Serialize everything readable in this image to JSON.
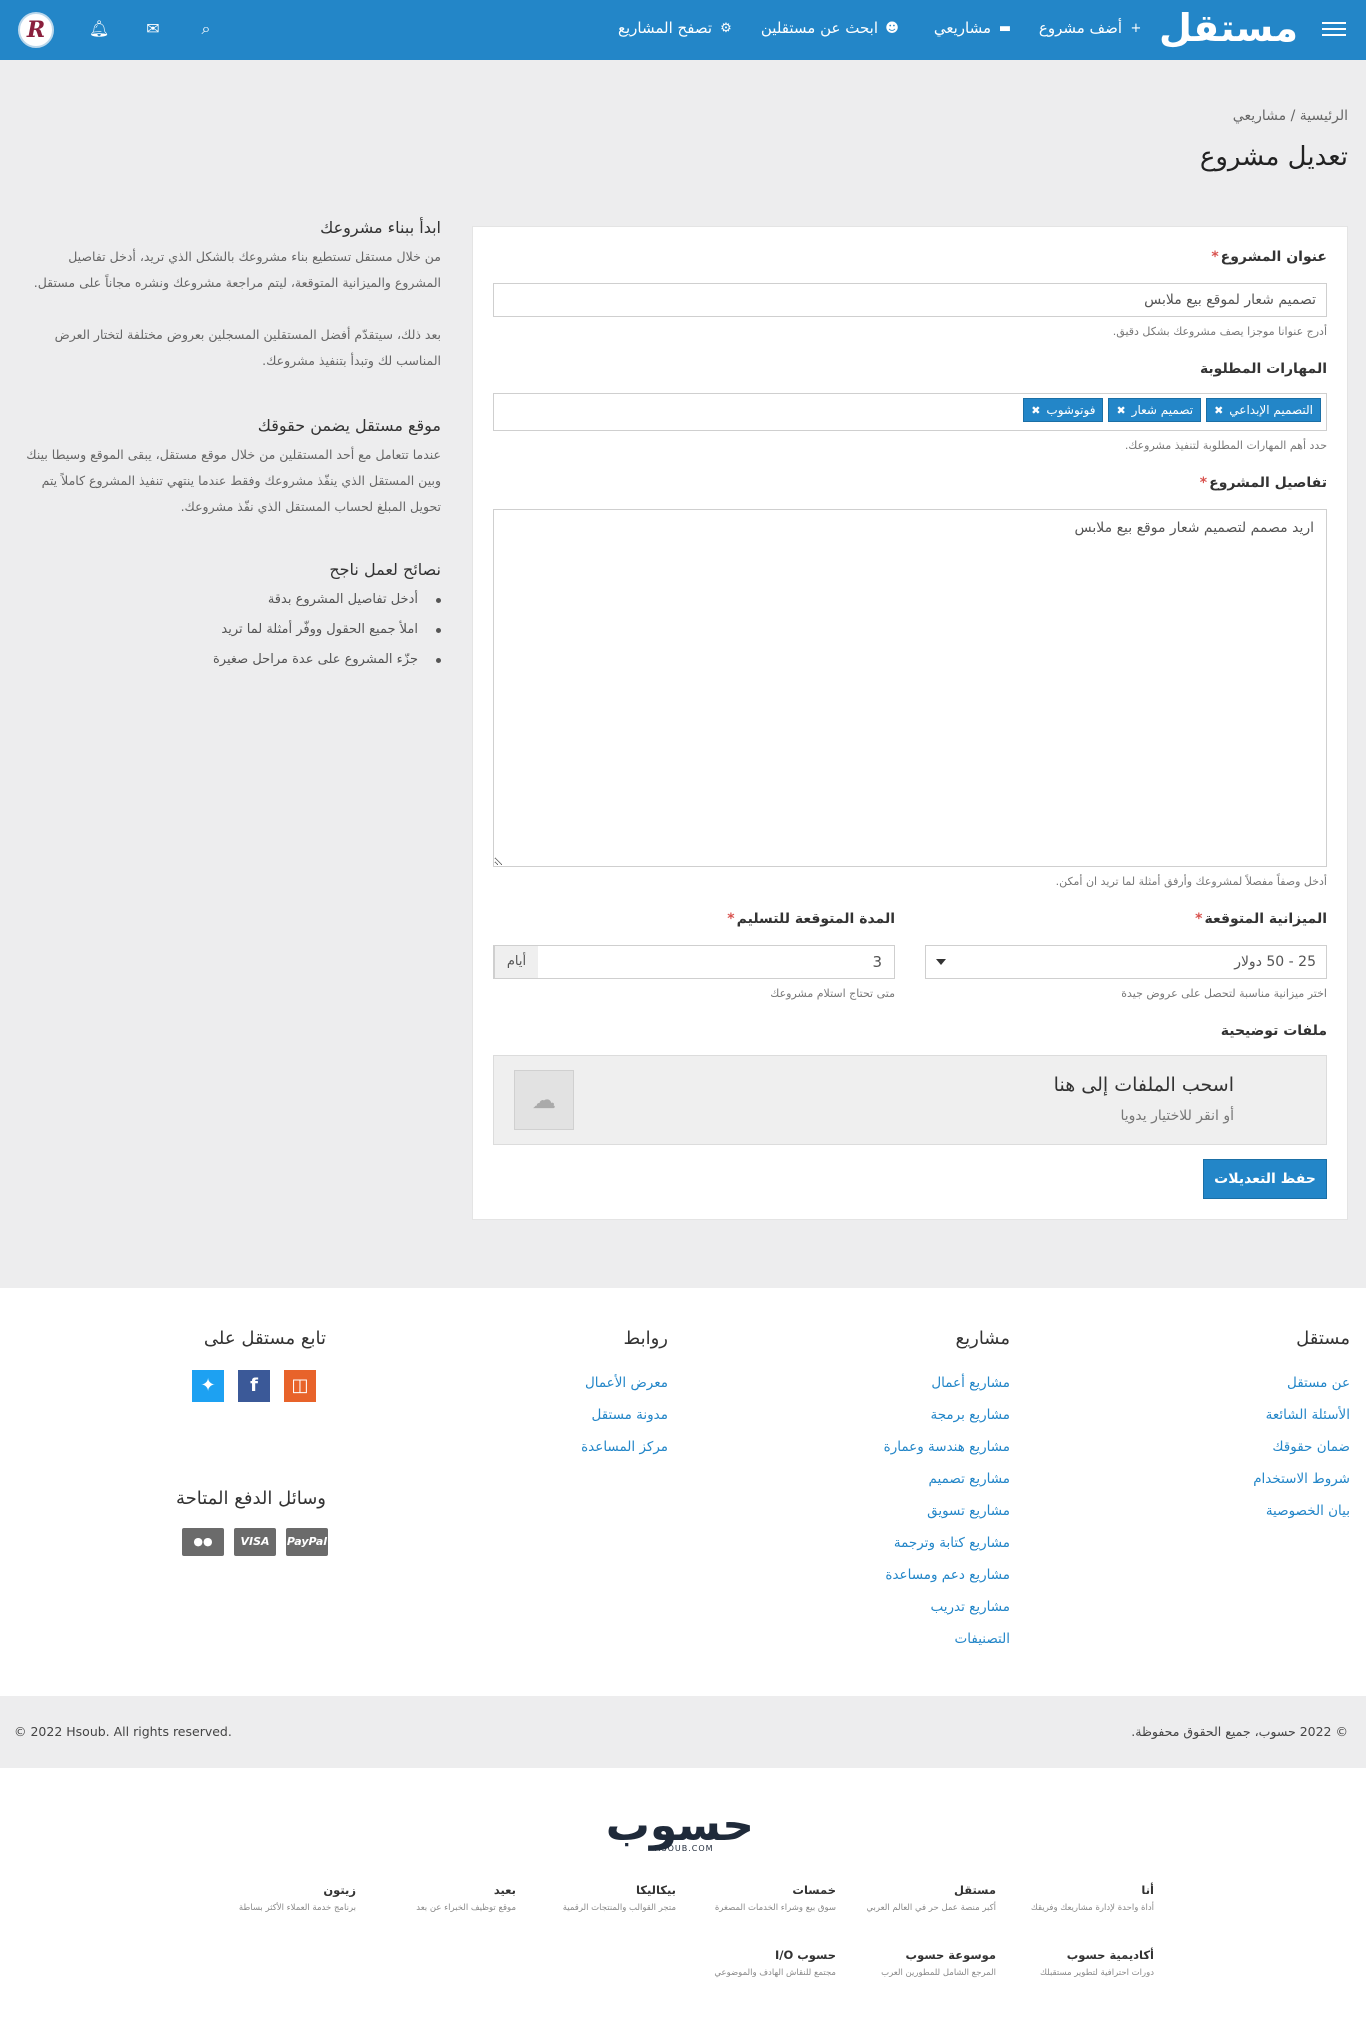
{
  "nav": {
    "logo": "مستقل",
    "items": [
      {
        "label": "أضف مشروع",
        "icon": "+"
      },
      {
        "label": "مشاريعي",
        "icon": "▬"
      },
      {
        "label": "ابحث عن مستقلين",
        "icon": "☻"
      },
      {
        "label": "تصفح المشاريع",
        "icon": "⚙"
      }
    ],
    "avatar_letter": "R"
  },
  "breadcrumb": {
    "home": "الرئيسية",
    "sep": "/",
    "current": "مشاريعي"
  },
  "page_title": "تعديل مشروع",
  "form": {
    "title_label": "عنوان المشروع",
    "title_value": "تصميم شعار لموقع بيع ملابس",
    "title_hint": "أدرج عنوانا موجزا يصف مشروعك بشكل دقيق.",
    "skills_label": "المهارات المطلوبة",
    "skills": [
      "التصميم الإبداعي",
      "تصميم شعار",
      "فوتوشوب"
    ],
    "skills_hint": "حدد أهم المهارات المطلوبة لتنفيذ مشروعك.",
    "details_label": "تفاصيل المشروع",
    "details_value": "اريد مصمم لتصميم شعار موقع بيع ملابس",
    "details_hint": "أدخل وصفاً مفصلاً لمشروعك وأرفق أمثلة لما تريد ان أمكن.",
    "budget_label": "الميزانية المتوقعة",
    "budget_value": "25 - 50 دولار",
    "budget_hint": "اختر ميزانية مناسبة لتحصل على عروض جيدة",
    "duration_label": "المدة المتوقعة للتسليم",
    "duration_value": "3",
    "duration_unit": "أيام",
    "duration_hint": "متى تحتاج استلام مشروعك",
    "files_label": "ملفات توضيحية",
    "drop_title": "اسحب الملفات إلى هنا",
    "drop_sub": "أو انقر للاختيار يدويا",
    "save_label": "حفظ التعديلات"
  },
  "side": {
    "s1_title": "ابدأ ببناء مشروعك",
    "s1_text1": "من خلال مستقل تستطيع بناء مشروعك بالشكل الذي تريد، أدخل تفاصيل المشروع والميزانية المتوقعة، ليتم مراجعة مشروعك ونشره مجاناً على مستقل.",
    "s1_text2": "بعد ذلك، سيتقدّم أفضل المستقلين المسجلين بعروض مختلفة لتختار العرض المناسب لك وتبدأ بتنفيذ مشروعك.",
    "s2_title": "موقع مستقل يضمن حقوقك",
    "s2_text": "عندما تتعامل مع أحد المستقلين من خلال موقع مستقل، يبقى الموقع وسيطا بينك وبين المستقل الذي ينفّذ مشروعك وفقط عندما ينتهي تنفيذ المشروع كاملاً يتم تحويل المبلغ لحساب المستقل الذي نفّذ مشروعك.",
    "s3_title": "نصائح لعمل ناجح",
    "tips": [
      "أدخل تفاصيل المشروع بدقة",
      "املأ جميع الحقول ووفّر أمثلة لما تريد",
      "جزّء المشروع على عدة مراحل صغيرة"
    ]
  },
  "footer": {
    "col1": {
      "title": "مستقل",
      "links": [
        "عن مستقل",
        "الأسئلة الشائعة",
        "ضمان حقوقك",
        "شروط الاستخدام",
        "بيان الخصوصية"
      ]
    },
    "col2": {
      "title": "مشاريع",
      "links": [
        "مشاريع أعمال",
        "مشاريع برمجة",
        "مشاريع هندسة وعمارة",
        "مشاريع تصميم",
        "مشاريع تسويق",
        "مشاريع كتابة وترجمة",
        "مشاريع دعم ومساعدة",
        "مشاريع تدريب",
        "التصنيفات"
      ]
    },
    "col3": {
      "title": "روابط",
      "links": [
        "معرض الأعمال",
        "مدونة مستقل",
        "مركز المساعدة"
      ]
    },
    "follow_title": "تابع مستقل على",
    "pay_title": "وسائل الدفع المتاحة",
    "pay": [
      "PayPal",
      "VISA",
      "●●"
    ],
    "copy_ar": "© 2022 حسوب، جميع الحقوق محفوظة.",
    "copy_en": "© 2022 Hsoub. All rights reserved."
  },
  "hsoub": {
    "logo": "حسوب",
    "logo_sub": "HSOUB.COM",
    "row1": [
      {
        "name": "أنا",
        "desc": "أداة واحدة لإدارة مشاريعك وفريقك"
      },
      {
        "name": "مستقل",
        "desc": "أكبر منصة عمل حر في العالم العربي"
      },
      {
        "name": "خمسات",
        "desc": "سوق بيع وشراء الخدمات المصغرة"
      },
      {
        "name": "بيكاليكا",
        "desc": "متجر القوالب والمنتجات الرقمية"
      },
      {
        "name": "بعيد",
        "desc": "موقع توظيف الخبراء عن بعد"
      },
      {
        "name": "زيتون",
        "desc": "برنامج خدمة العملاء الأكثر بساطة"
      }
    ],
    "row2": [
      {
        "name": "أكاديمية حسوب",
        "desc": "دورات احترافية لتطوير مستقبلك"
      },
      {
        "name": "موسوعة حسوب",
        "desc": "المرجع الشامل للمطورين العرب"
      },
      {
        "name": "حسوب I/O",
        "desc": "مجتمع للنقاش الهادف والموضوعي"
      }
    ]
  }
}
